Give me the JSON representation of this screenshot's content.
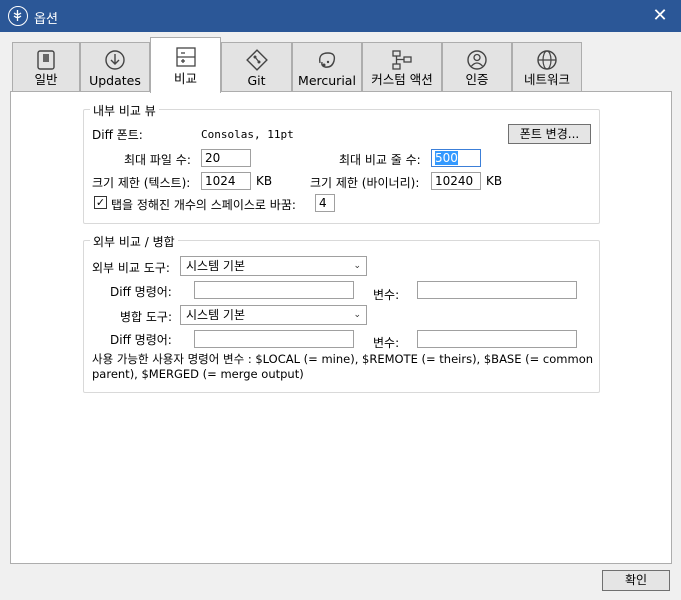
{
  "window": {
    "title": "옵션",
    "close_glyph": "✕"
  },
  "tabs": [
    {
      "label": "일반",
      "icon": "switch-icon"
    },
    {
      "label": "Updates",
      "icon": "download-icon"
    },
    {
      "label": "비교",
      "icon": "diff-icon"
    },
    {
      "label": "Git",
      "icon": "git-icon"
    },
    {
      "label": "Mercurial",
      "icon": "mercurial-icon"
    },
    {
      "label": "커스텀 액션",
      "icon": "flow-icon"
    },
    {
      "label": "인증",
      "icon": "user-icon"
    },
    {
      "label": "네트워크",
      "icon": "globe-icon"
    }
  ],
  "active_tab": "비교",
  "internal": {
    "title": "내부 비교 뷰",
    "diff_font_label": "Diff 폰트:",
    "diff_font_value": "Consolas, 11pt",
    "change_font_button": "폰트 변경...",
    "max_files_label": "최대 파일 수:",
    "max_files_value": "20",
    "max_lines_label": "최대 비교 줄 수:",
    "max_lines_value": "500",
    "size_text_label": "크기 제한 (텍스트):",
    "size_text_value": "1024",
    "size_text_unit": "KB",
    "size_binary_label": "크기 제한 (바이너리):",
    "size_binary_value": "10240",
    "size_binary_unit": "KB",
    "tabs_checkbox_label": "탭을 정해진 개수의 스페이스로 바꿈:",
    "tabs_checkbox_checked": true,
    "tabs_spaces_value": "4"
  },
  "external": {
    "title": "외부 비교 / 병합",
    "diff_tool_label": "외부 비교 도구:",
    "diff_tool_value": "시스템 기본",
    "diff_cmd_label": "Diff 명령어:",
    "diff_cmd_value": "",
    "diff_args_label": "변수:",
    "diff_args_value": "",
    "merge_tool_label": "병합 도구:",
    "merge_tool_value": "시스템 기본",
    "merge_cmd_label": "Diff 명령어:",
    "merge_cmd_value": "",
    "merge_args_label": "변수:",
    "merge_args_value": "",
    "note_line1": "사용 가능한 사용자 명령어 변수 : $LOCAL (= mine), $REMOTE (= theirs), $BASE (= common",
    "note_line2": "parent), $MERGED (= merge output)"
  },
  "footer": {
    "ok_button": "확인"
  },
  "colors": {
    "titlebar": "#2b5797",
    "selection": "#3399ff"
  }
}
